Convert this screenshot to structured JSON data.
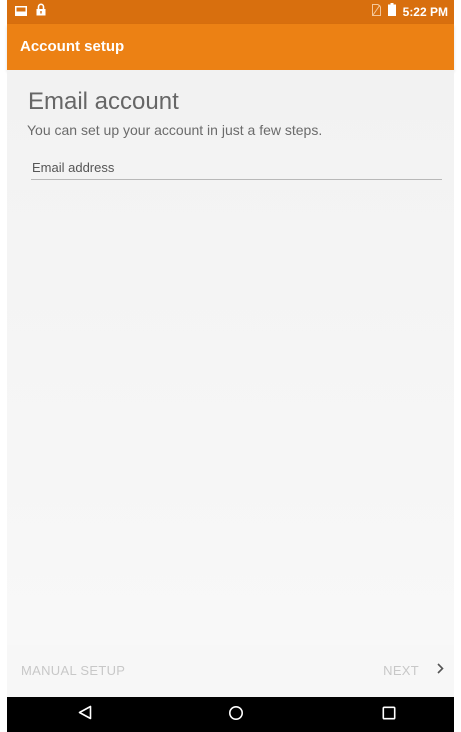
{
  "status_bar": {
    "time": "5:22 PM",
    "icons": [
      "screenshot-icon",
      "lock-icon",
      "no-sim-icon",
      "battery-icon"
    ],
    "bg_color": "#d86f0e"
  },
  "app_bar": {
    "title": "Account setup",
    "bg_color": "#ec8114"
  },
  "content": {
    "heading": "Email account",
    "subheading": "You can set up your account in just a few steps.",
    "email_field": {
      "placeholder": "Email address",
      "value": ""
    }
  },
  "buttons": {
    "manual_setup": "MANUAL SETUP",
    "next": "NEXT",
    "next_icon": "chevron-right-icon"
  },
  "nav_bar": {
    "icons": [
      "back-icon",
      "home-icon",
      "recents-icon"
    ]
  }
}
